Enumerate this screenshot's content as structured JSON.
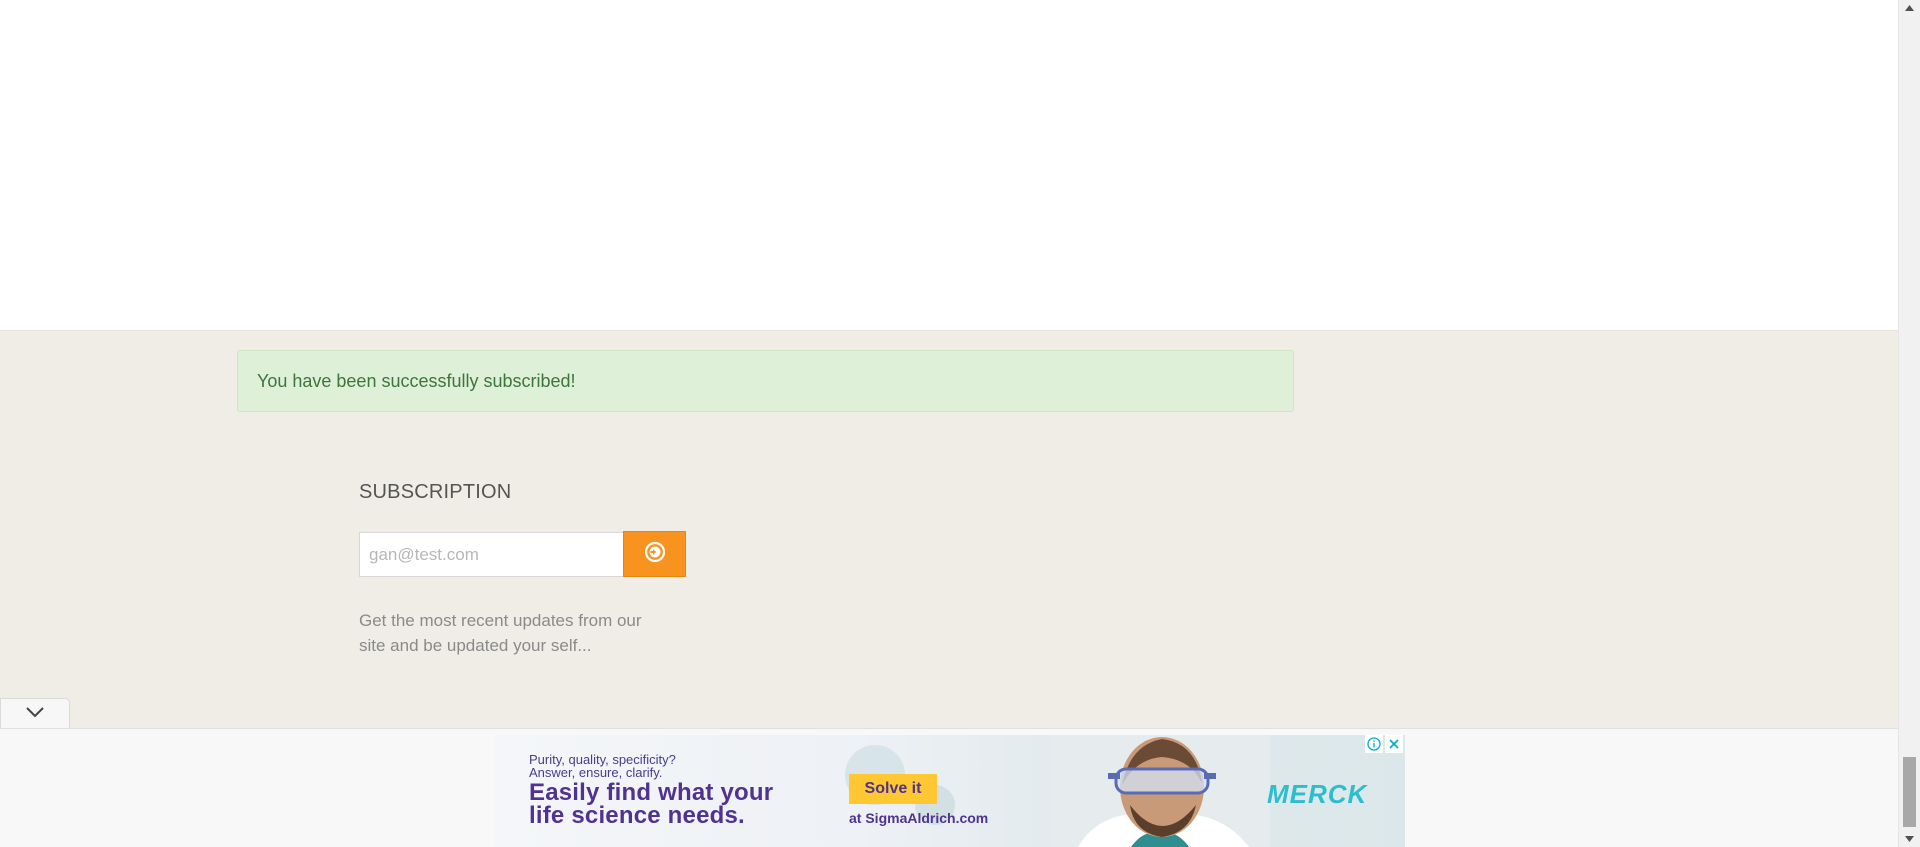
{
  "alert": {
    "message": "You have been successfully subscribed!"
  },
  "subscription": {
    "title": "SUBSCRIPTION",
    "email_placeholder": "gan@test.com",
    "submit_icon": "arrow-circle-right-icon",
    "description": "Get the most recent updates from our site and be updated your self..."
  },
  "collapse_tab": {
    "icon": "chevron-down-icon"
  },
  "ad": {
    "tagline_line1": "Purity, quality, specificity?",
    "tagline_line2": "Answer, ensure, clarify.",
    "headline_line1": "Easily find what your",
    "headline_line2": "life science needs.",
    "cta_label": "Solve it",
    "site": "at SigmaAldrich.com",
    "brand": "MERCK",
    "info_icon": "info-icon",
    "close_icon": "close-icon",
    "colors": {
      "purple": "#503291",
      "yellow": "#ffc832",
      "teal": "#2dbecd"
    }
  },
  "colors": {
    "footer_bg": "#efede6",
    "alert_bg": "#dff0d8",
    "alert_text": "#3c763d",
    "accent_orange": "#f7931e"
  }
}
